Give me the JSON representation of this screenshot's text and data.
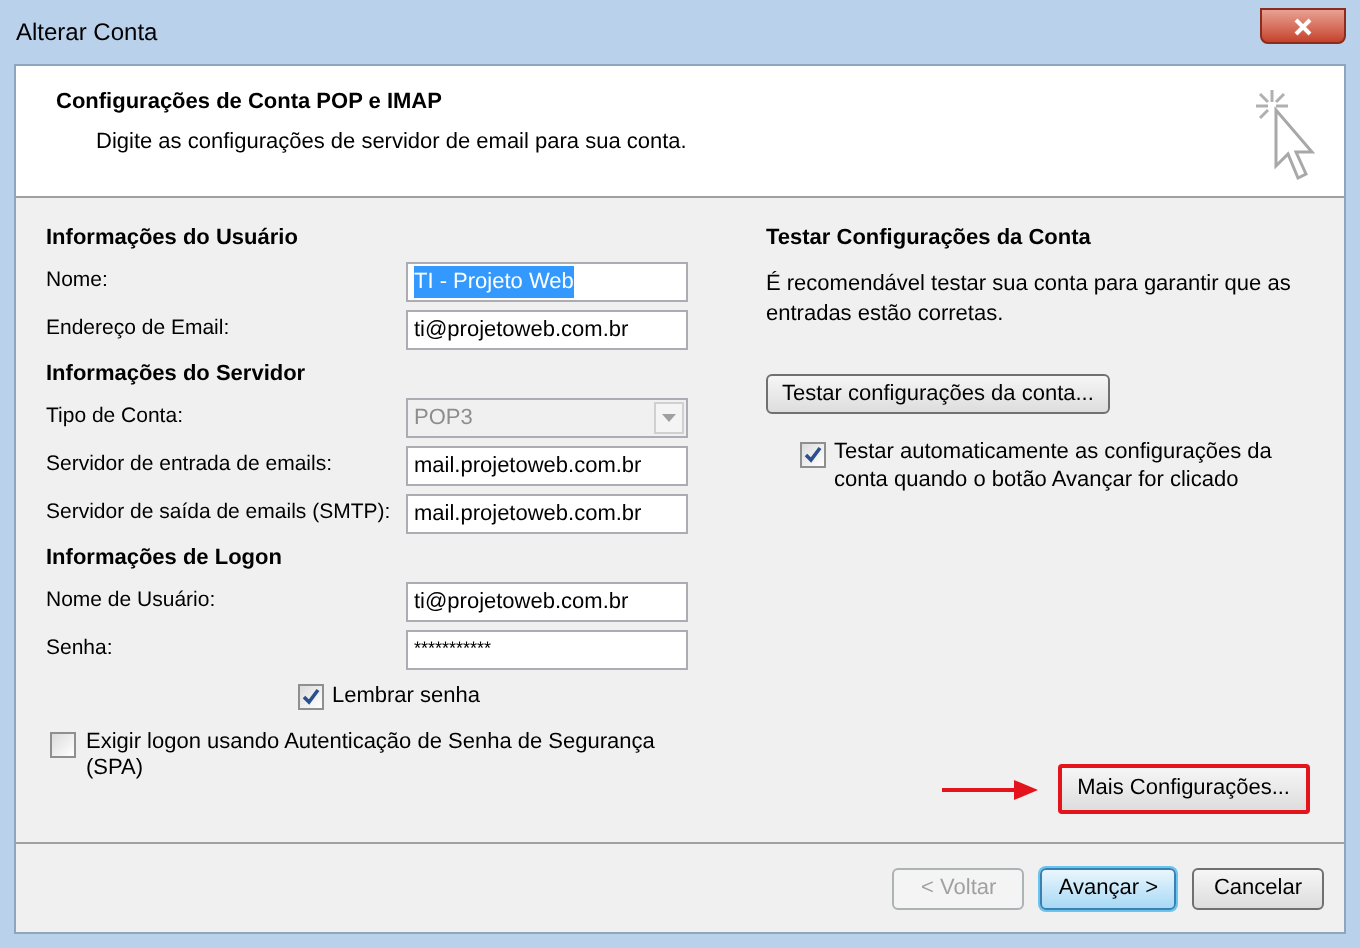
{
  "window": {
    "title": "Alterar Conta"
  },
  "header": {
    "title": "Configurações de Conta POP e IMAP",
    "subtitle": "Digite as configurações de servidor de email para sua conta."
  },
  "sections": [
    {
      "title": "Informações do Usuário",
      "fields": [
        {
          "kind": "text",
          "label": "Nome:",
          "value": "TI - Projeto Web",
          "highlighted": true
        },
        {
          "kind": "text",
          "label": "Endereço de Email:",
          "value": "ti@projetoweb.com.br",
          "highlighted": false
        }
      ]
    },
    {
      "title": "Informações do Servidor",
      "fields": [
        {
          "kind": "select",
          "label": "Tipo de Conta:",
          "value": "POP3",
          "disabled": true
        },
        {
          "kind": "text",
          "label": "Servidor de entrada de emails:",
          "value": "mail.projetoweb.com.br",
          "highlighted": false
        },
        {
          "kind": "text",
          "label": "Servidor de saída de emails (SMTP):",
          "value": "mail.projetoweb.com.br",
          "highlighted": false
        }
      ]
    },
    {
      "title": "Informações de Logon",
      "fields": [
        {
          "kind": "text",
          "label": "Nome de Usuário:",
          "value": "ti@projetoweb.com.br",
          "highlighted": false
        },
        {
          "kind": "password",
          "label": "Senha:",
          "value": "***********"
        }
      ]
    }
  ],
  "remember_password": {
    "label": "Lembrar senha",
    "checked": true
  },
  "require_spa": {
    "label": "Exigir logon usando Autenticação de Senha de Segurança (SPA)",
    "checked": false
  },
  "test": {
    "title": "Testar Configurações da Conta",
    "description": "É recomendável testar sua conta para garantir que as entradas estão corretas.",
    "button": "Testar configurações da conta...",
    "auto_test": {
      "label": "Testar automaticamente as configurações da conta quando o botão Avançar for clicado",
      "checked": true
    }
  },
  "more_settings": {
    "label": "Mais Configurações...",
    "highlighted": true
  },
  "buttons": [
    {
      "label": "< Voltar",
      "disabled": true,
      "default": false
    },
    {
      "label": "Avançar >",
      "disabled": false,
      "default": true
    },
    {
      "label": "Cancelar",
      "disabled": false,
      "default": false
    }
  ]
}
